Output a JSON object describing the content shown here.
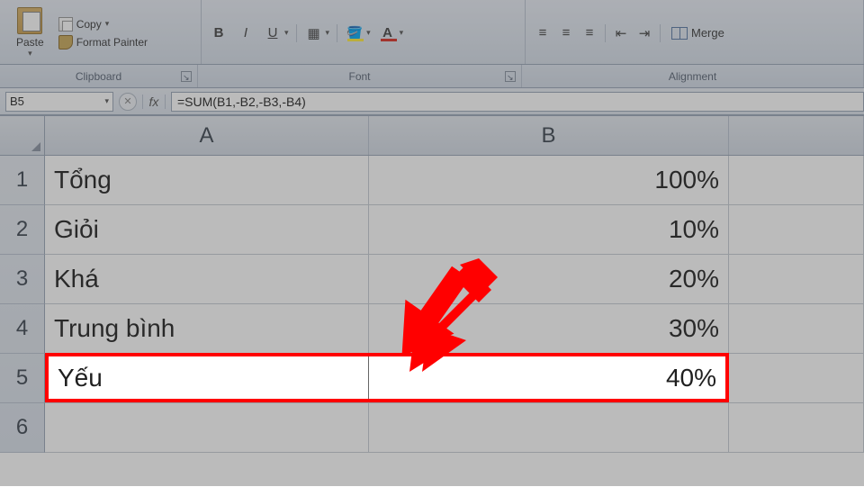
{
  "ribbon": {
    "paste_label": "Paste",
    "copy_label": "Copy",
    "format_painter_label": "Format Painter",
    "merge_label": "Merge",
    "group_clipboard": "Clipboard",
    "group_font": "Font",
    "group_alignment": "Alignment"
  },
  "formula_bar": {
    "name_box": "B5",
    "fx_label": "fx",
    "formula": "=SUM(B1,-B2,-B3,-B4)"
  },
  "columns": [
    "A",
    "B"
  ],
  "rows": [
    {
      "n": "1",
      "a": "Tổng",
      "b": "100%"
    },
    {
      "n": "2",
      "a": "Giỏi",
      "b": "10%"
    },
    {
      "n": "3",
      "a": "Khá",
      "b": "20%"
    },
    {
      "n": "4",
      "a": "Trung bình",
      "b": "30%"
    },
    {
      "n": "5",
      "a": "Yếu",
      "b": "40%"
    },
    {
      "n": "6",
      "a": "",
      "b": ""
    }
  ],
  "highlight": {
    "a": "Yếu",
    "b": "40%"
  },
  "chart_data": {
    "type": "table",
    "title": "",
    "columns": [
      "A",
      "B"
    ],
    "rows": [
      [
        "Tổng",
        "100%"
      ],
      [
        "Giỏi",
        "10%"
      ],
      [
        "Khá",
        "20%"
      ],
      [
        "Trung bình",
        "30%"
      ],
      [
        "Yếu",
        "40%"
      ]
    ]
  }
}
